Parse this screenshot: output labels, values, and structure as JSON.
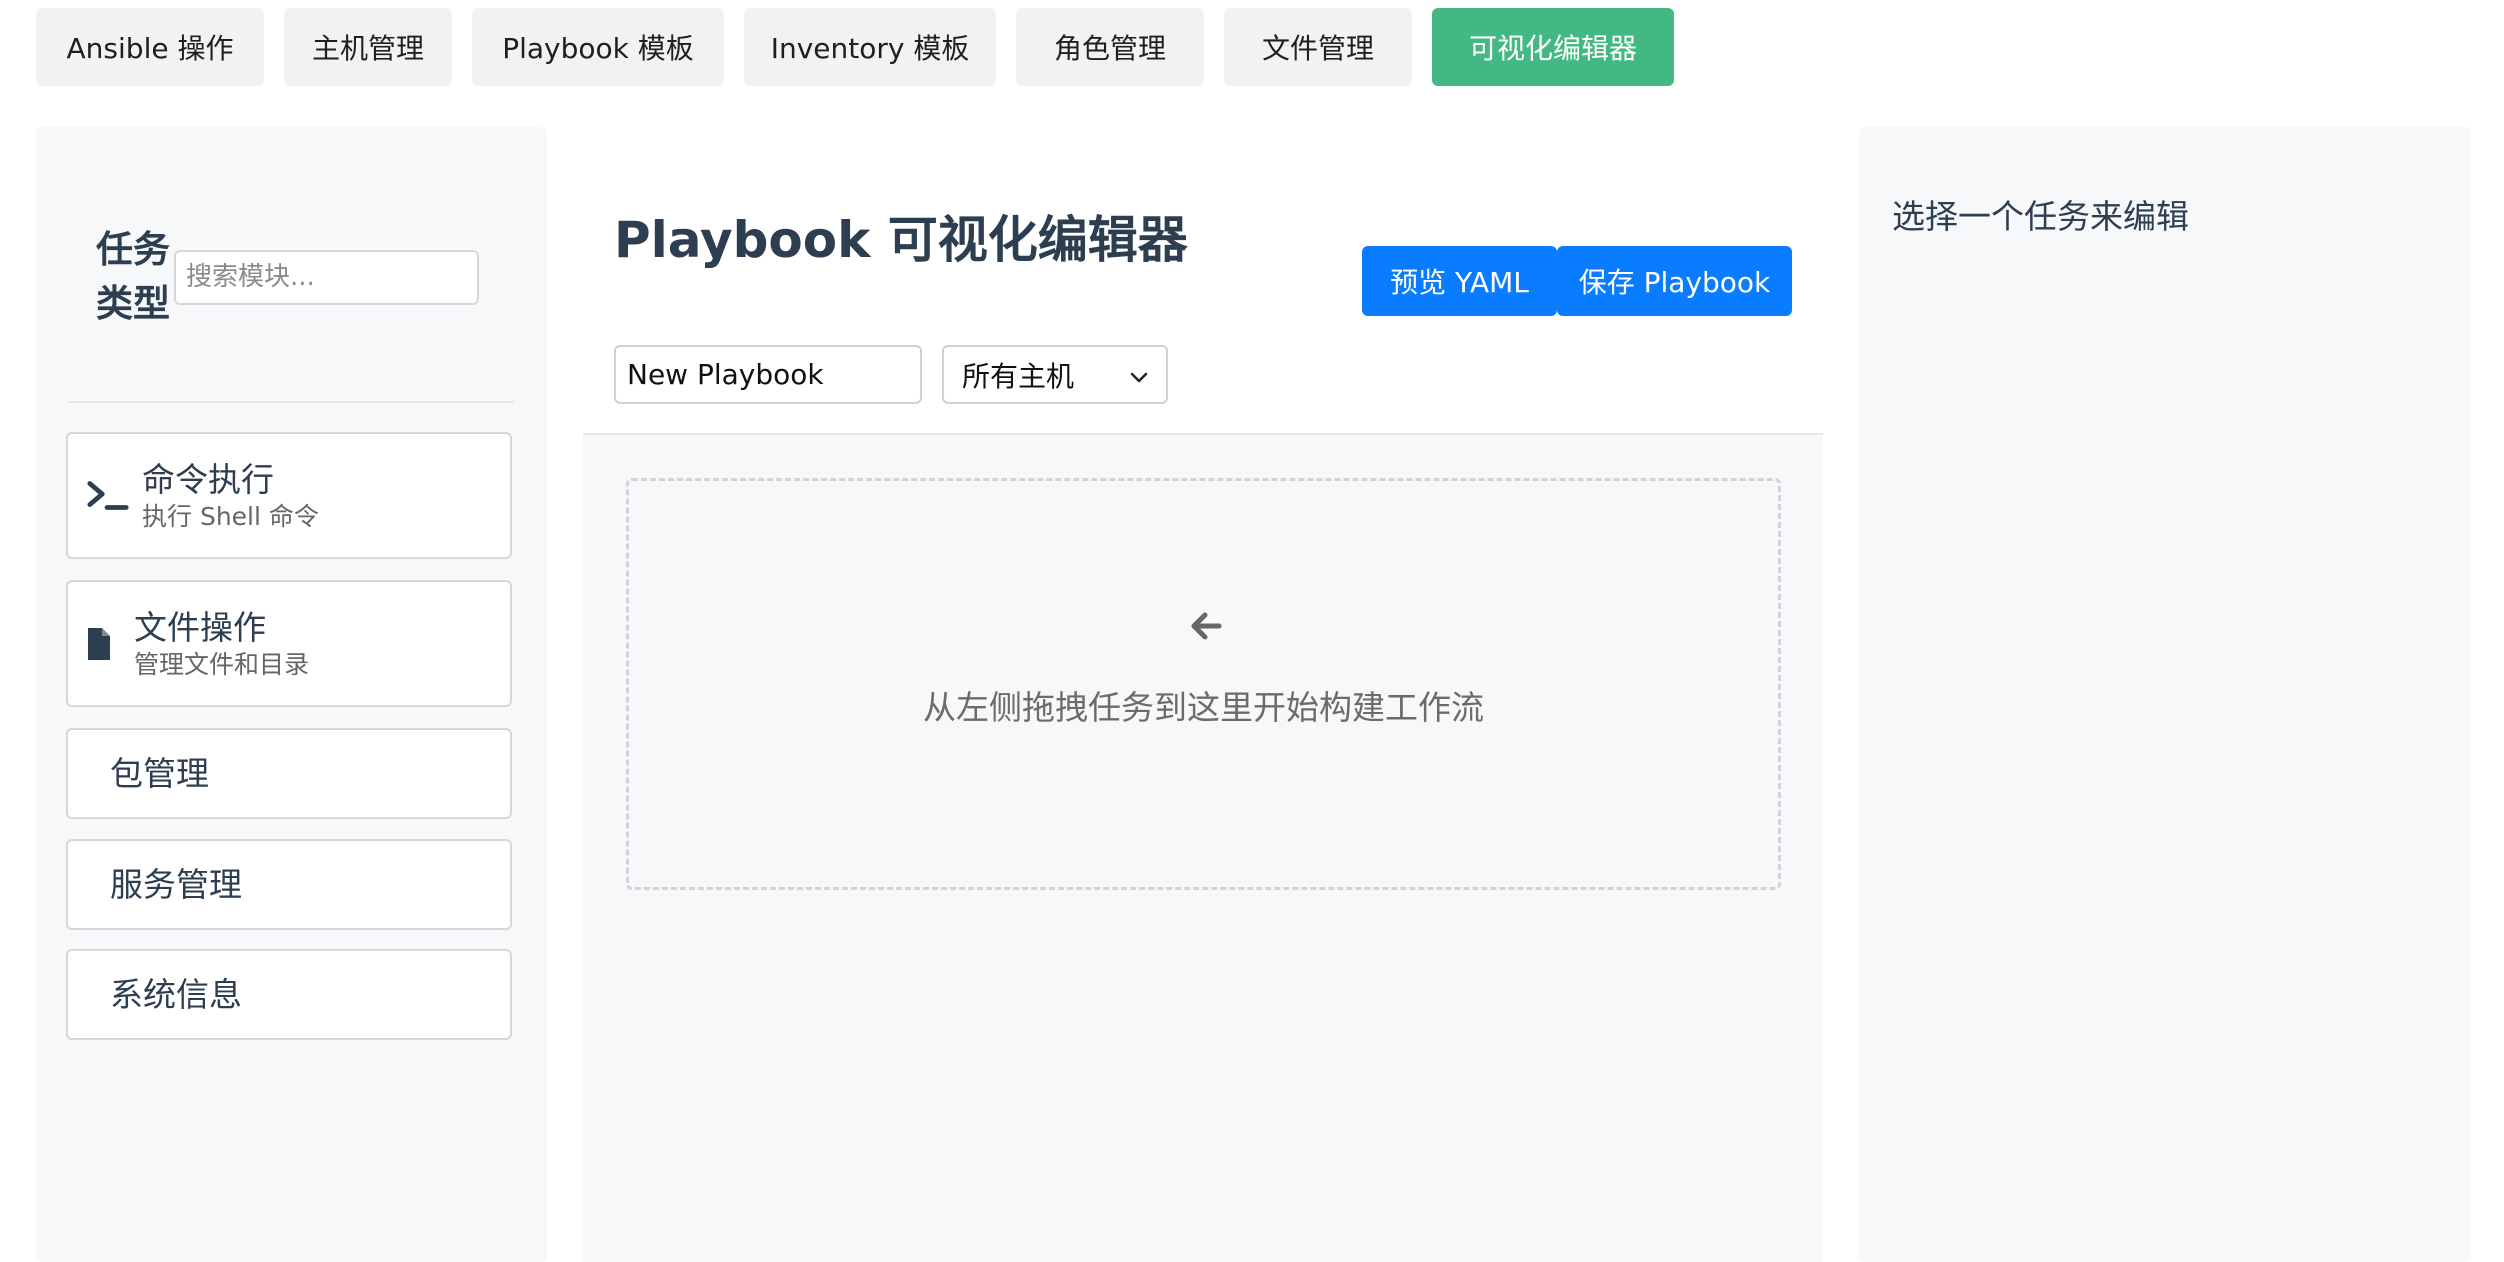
{
  "nav": {
    "items": [
      {
        "label": "Ansible 操作"
      },
      {
        "label": "主机管理"
      },
      {
        "label": "Playbook 模板"
      },
      {
        "label": "Inventory 模板"
      },
      {
        "label": "角色管理"
      },
      {
        "label": "文件管理"
      },
      {
        "label": "可视化编辑器"
      }
    ],
    "active": "可视化编辑器"
  },
  "sidebar": {
    "title": "任务类型",
    "search_placeholder": "搜索模块...",
    "tasks": [
      {
        "name": "命令执行",
        "desc": "执行 Shell 命令",
        "icon": "terminal-icon"
      },
      {
        "name": "文件操作",
        "desc": "管理文件和目录",
        "icon": "file-icon"
      },
      {
        "name": "包管理"
      },
      {
        "name": "服务管理"
      },
      {
        "name": "系统信息"
      }
    ]
  },
  "editor": {
    "title": "Playbook 可视化编辑器",
    "preview_label": "预览 YAML",
    "save_label": "保存 Playbook",
    "playbook_name": "New Playbook",
    "hosts_selected": "所有主机",
    "drop_hint": "从左侧拖拽任务到这里开始构建工作流",
    "drop_icon": "arrow-left-icon"
  },
  "properties": {
    "empty_text": "选择一个任务来编辑"
  },
  "colors": {
    "accent_green": "#42b883",
    "primary_blue": "#0a7cff",
    "text_dark": "#2c3e50"
  }
}
